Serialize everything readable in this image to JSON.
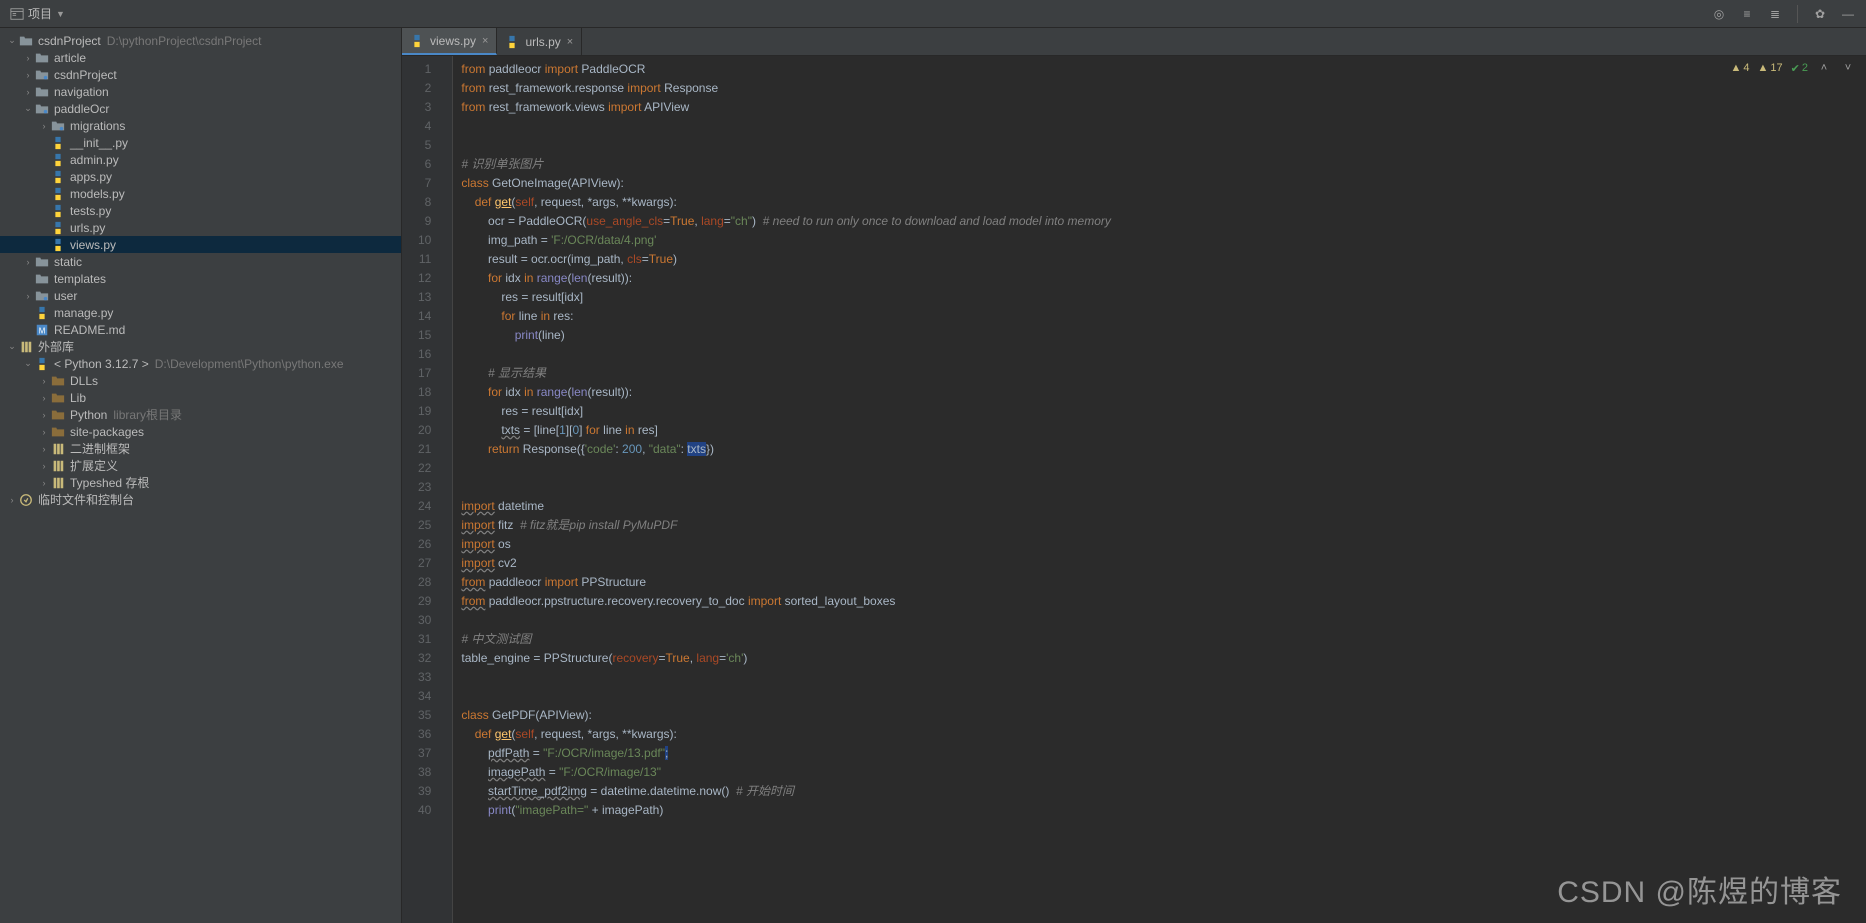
{
  "toolbar": {
    "project_label": "项目"
  },
  "tabs": [
    {
      "name": "views.py",
      "active": true
    },
    {
      "name": "urls.py",
      "active": false
    }
  ],
  "inspections": {
    "warn1": "4",
    "warn2": "17",
    "ok": "2"
  },
  "tree": [
    {
      "depth": 0,
      "arrow": "down",
      "icon": "folder-root",
      "label": "csdnProject",
      "muted": "D:\\pythonProject\\csdnProject"
    },
    {
      "depth": 1,
      "arrow": "right",
      "icon": "folder",
      "label": "article"
    },
    {
      "depth": 1,
      "arrow": "right",
      "icon": "folder-pkg",
      "label": "csdnProject"
    },
    {
      "depth": 1,
      "arrow": "right",
      "icon": "folder",
      "label": "navigation"
    },
    {
      "depth": 1,
      "arrow": "down",
      "icon": "folder-pkg",
      "label": "paddleOcr"
    },
    {
      "depth": 2,
      "arrow": "right",
      "icon": "folder-pkg",
      "label": "migrations"
    },
    {
      "depth": 2,
      "arrow": "",
      "icon": "py",
      "label": "__init__.py"
    },
    {
      "depth": 2,
      "arrow": "",
      "icon": "py",
      "label": "admin.py"
    },
    {
      "depth": 2,
      "arrow": "",
      "icon": "py",
      "label": "apps.py"
    },
    {
      "depth": 2,
      "arrow": "",
      "icon": "py",
      "label": "models.py"
    },
    {
      "depth": 2,
      "arrow": "",
      "icon": "py",
      "label": "tests.py"
    },
    {
      "depth": 2,
      "arrow": "",
      "icon": "py",
      "label": "urls.py"
    },
    {
      "depth": 2,
      "arrow": "",
      "icon": "py",
      "label": "views.py",
      "selected": true
    },
    {
      "depth": 1,
      "arrow": "right",
      "icon": "folder",
      "label": "static"
    },
    {
      "depth": 1,
      "arrow": "",
      "icon": "folder",
      "label": "templates"
    },
    {
      "depth": 1,
      "arrow": "right",
      "icon": "folder-pkg",
      "label": "user"
    },
    {
      "depth": 1,
      "arrow": "",
      "icon": "py",
      "label": "manage.py"
    },
    {
      "depth": 1,
      "arrow": "",
      "icon": "md",
      "label": "README.md"
    },
    {
      "depth": 0,
      "arrow": "down",
      "icon": "lib",
      "label": "外部库"
    },
    {
      "depth": 1,
      "arrow": "down",
      "icon": "py-env",
      "label": "< Python 3.12.7 >",
      "muted": "D:\\Development\\Python\\python.exe"
    },
    {
      "depth": 2,
      "arrow": "right",
      "icon": "folder-lib",
      "label": "DLLs"
    },
    {
      "depth": 2,
      "arrow": "right",
      "icon": "folder-lib",
      "label": "Lib"
    },
    {
      "depth": 2,
      "arrow": "right",
      "icon": "folder-lib",
      "label": "Python",
      "muted": "library根目录"
    },
    {
      "depth": 2,
      "arrow": "right",
      "icon": "folder-lib",
      "label": "site-packages"
    },
    {
      "depth": 2,
      "arrow": "right",
      "icon": "lib",
      "label": "二进制框架"
    },
    {
      "depth": 2,
      "arrow": "right",
      "icon": "lib",
      "label": "扩展定义"
    },
    {
      "depth": 2,
      "arrow": "right",
      "icon": "lib",
      "label": "Typeshed 存根"
    },
    {
      "depth": 0,
      "arrow": "right",
      "icon": "scratch",
      "label": "临时文件和控制台"
    }
  ],
  "code_lines": [
    {
      "n": 1,
      "html": "<span class='kw'>from</span> paddleocr <span class='kw'>import</span> PaddleOCR"
    },
    {
      "n": 2,
      "html": "<span class='kw'>from</span> rest_framework.response <span class='kw'>import</span> Response"
    },
    {
      "n": 3,
      "html": "<span class='kw'>from</span> rest_framework.views <span class='kw'>import</span> APIView"
    },
    {
      "n": 4,
      "html": ""
    },
    {
      "n": 5,
      "html": ""
    },
    {
      "n": 6,
      "html": "<span class='cm'># 识别单张图片</span>"
    },
    {
      "n": 7,
      "html": "<span class='kw'>class</span> <span class='cls'>GetOneImage</span>(APIView):"
    },
    {
      "n": 8,
      "html": "    <span class='kw'>def</span> <span class='fn-u'>get</span>(<span class='arg'>self</span>, request, *args, **kwargs):"
    },
    {
      "n": 9,
      "html": "        ocr = PaddleOCR(<span class='arg'>use_angle_cls</span>=<span class='kw'>True</span>, <span class='arg'>lang</span>=<span class='str'>\"ch\"</span>)  <span class='cm'># need to run only once to download and load model into memory</span>"
    },
    {
      "n": 10,
      "html": "        img_path = <span class='str'>'F:/OCR/data/4.png'</span>"
    },
    {
      "n": 11,
      "html": "        result = ocr.ocr(img_path, <span class='arg'>cls</span>=<span class='kw'>True</span>)"
    },
    {
      "n": 12,
      "html": "        <span class='kw'>for</span> idx <span class='kw'>in</span> <span class='bi'>range</span>(<span class='bi'>len</span>(result)):"
    },
    {
      "n": 13,
      "html": "            res = result[idx]"
    },
    {
      "n": 14,
      "html": "            <span class='kw'>for</span> line <span class='kw'>in</span> res:"
    },
    {
      "n": 15,
      "html": "                <span class='bi'>print</span>(line)"
    },
    {
      "n": 16,
      "html": ""
    },
    {
      "n": 17,
      "html": "        <span class='cm'># 显示结果</span>"
    },
    {
      "n": 18,
      "html": "        <span class='kw'>for</span> idx <span class='kw'>in</span> <span class='bi'>range</span>(<span class='bi'>len</span>(result)):"
    },
    {
      "n": 19,
      "html": "            res = result[idx]"
    },
    {
      "n": 20,
      "html": "            <span class='u-wavy'>txts</span> = [line[<span class='num'>1</span>][<span class='num'>0</span>] <span class='kw'>for</span> line <span class='kw'>in</span> res]"
    },
    {
      "n": 21,
      "html": "        <span class='kw'>return</span> Response({<span class='str'>'code'</span>: <span class='num'>200</span>, <span class='str'>\"data\"</span>: <span class='hi'>txts</span>})"
    },
    {
      "n": 22,
      "html": ""
    },
    {
      "n": 23,
      "html": ""
    },
    {
      "n": 24,
      "html": "<span class='kw-u'>import</span> datetime"
    },
    {
      "n": 25,
      "html": "<span class='kw-u'>import</span> fitz  <span class='cm'># fitz就是pip install PyMuPDF</span>"
    },
    {
      "n": 26,
      "html": "<span class='kw-u'>import</span> os"
    },
    {
      "n": 27,
      "html": "<span class='kw-u'>import</span> cv2"
    },
    {
      "n": 28,
      "html": "<span class='kw-u'>from</span> paddleocr <span class='kw'>import</span> PPStructure"
    },
    {
      "n": 29,
      "html": "<span class='kw-u'>from</span> paddleocr.ppstructure.recovery.recovery_to_doc <span class='kw'>import</span> sorted_layout_boxes"
    },
    {
      "n": 30,
      "html": ""
    },
    {
      "n": 31,
      "html": "<span class='cm'># 中文测试图</span>"
    },
    {
      "n": 32,
      "html": "table_engine = PPStructure(<span class='arg'>recovery</span>=<span class='kw'>True</span>, <span class='arg'>lang</span>=<span class='str'>'ch'</span>)"
    },
    {
      "n": 33,
      "html": ""
    },
    {
      "n": 34,
      "html": ""
    },
    {
      "n": 35,
      "html": "<span class='kw'>class</span> <span class='cls'>GetPDF</span>(APIView):"
    },
    {
      "n": 36,
      "html": "    <span class='kw'>def</span> <span class='fn-u'>get</span>(<span class='arg'>self</span>, request, *args, **kwargs):"
    },
    {
      "n": 37,
      "html": "        <span class='u-wavy'>pdfPath</span> = <span class='str'>\"F:/OCR/image/13.pdf\"</span><span class='hi'>;</span>"
    },
    {
      "n": 38,
      "html": "        <span class='u-wavy'>imagePath</span> = <span class='str'>\"F:/OCR/image/13\"</span>"
    },
    {
      "n": 39,
      "html": "        <span class='u-wavy'>startTime_pdf2img</span> = datetime.datetime.now()  <span class='cm'># 开始时间</span>"
    },
    {
      "n": 40,
      "html": "        <span class='bi'>print</span>(<span class='str'>\"imagePath=\"</span> + imagePath)"
    }
  ],
  "watermark": "CSDN @陈煜的博客"
}
